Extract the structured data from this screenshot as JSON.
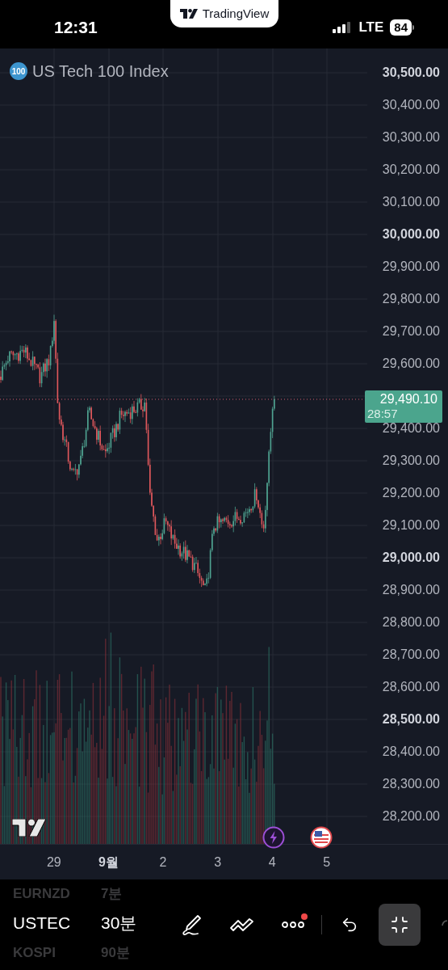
{
  "status_bar": {
    "time": "12:31",
    "app_banner": "TradingView",
    "network": "LTE",
    "battery": "84"
  },
  "chart": {
    "symbol_badge": "100",
    "title": "US Tech 100 Index",
    "price_axis_upper": [
      {
        "label": "30,500.00",
        "major": true
      },
      {
        "label": "30,400.00",
        "major": false
      },
      {
        "label": "30,300.00",
        "major": false
      },
      {
        "label": "30,200.00",
        "major": false
      },
      {
        "label": "30,100.00",
        "major": false
      },
      {
        "label": "30,000.00",
        "major": true
      },
      {
        "label": "29,900.00",
        "major": false
      },
      {
        "label": "29,800.00",
        "major": false
      },
      {
        "label": "29,700.00",
        "major": false
      },
      {
        "label": "29,600.00",
        "major": false
      }
    ],
    "price_axis_lower": [
      {
        "label": "29,400.00",
        "major": false
      },
      {
        "label": "29,300.00",
        "major": false
      },
      {
        "label": "29,200.00",
        "major": false
      },
      {
        "label": "29,100.00",
        "major": false
      },
      {
        "label": "29,000.00",
        "major": true
      },
      {
        "label": "28,900.00",
        "major": false
      },
      {
        "label": "28,800.00",
        "major": false
      },
      {
        "label": "28,700.00",
        "major": false
      },
      {
        "label": "28,600.00",
        "major": false
      },
      {
        "label": "28,500.00",
        "major": true
      },
      {
        "label": "28,400.00",
        "major": false
      },
      {
        "label": "28,300.00",
        "major": false
      },
      {
        "label": "28,200.00",
        "major": false
      }
    ],
    "last_price": {
      "price": "29,490.10",
      "countdown": "28:57"
    },
    "time_axis": [
      {
        "label": "29",
        "major": false
      },
      {
        "label": "9월",
        "major": true
      },
      {
        "label": "2",
        "major": false
      },
      {
        "label": "3",
        "major": false
      },
      {
        "label": "4",
        "major": false
      },
      {
        "label": "5",
        "major": false
      }
    ]
  },
  "toolbar": {
    "symbols": [
      {
        "label": "EURNZD",
        "selected": false
      },
      {
        "label": "USTEC",
        "selected": true
      },
      {
        "label": "KOSPI",
        "selected": false
      }
    ],
    "intervals": [
      {
        "label": "7분",
        "selected": false
      },
      {
        "label": "30분",
        "selected": true
      },
      {
        "label": "90분",
        "selected": false
      }
    ],
    "tools": [
      {
        "kind": "draw"
      },
      {
        "kind": "lines"
      },
      {
        "kind": "more",
        "notification": true
      },
      {
        "kind": "undo"
      },
      {
        "kind": "exit_fullscreen",
        "selected": true
      }
    ]
  }
}
